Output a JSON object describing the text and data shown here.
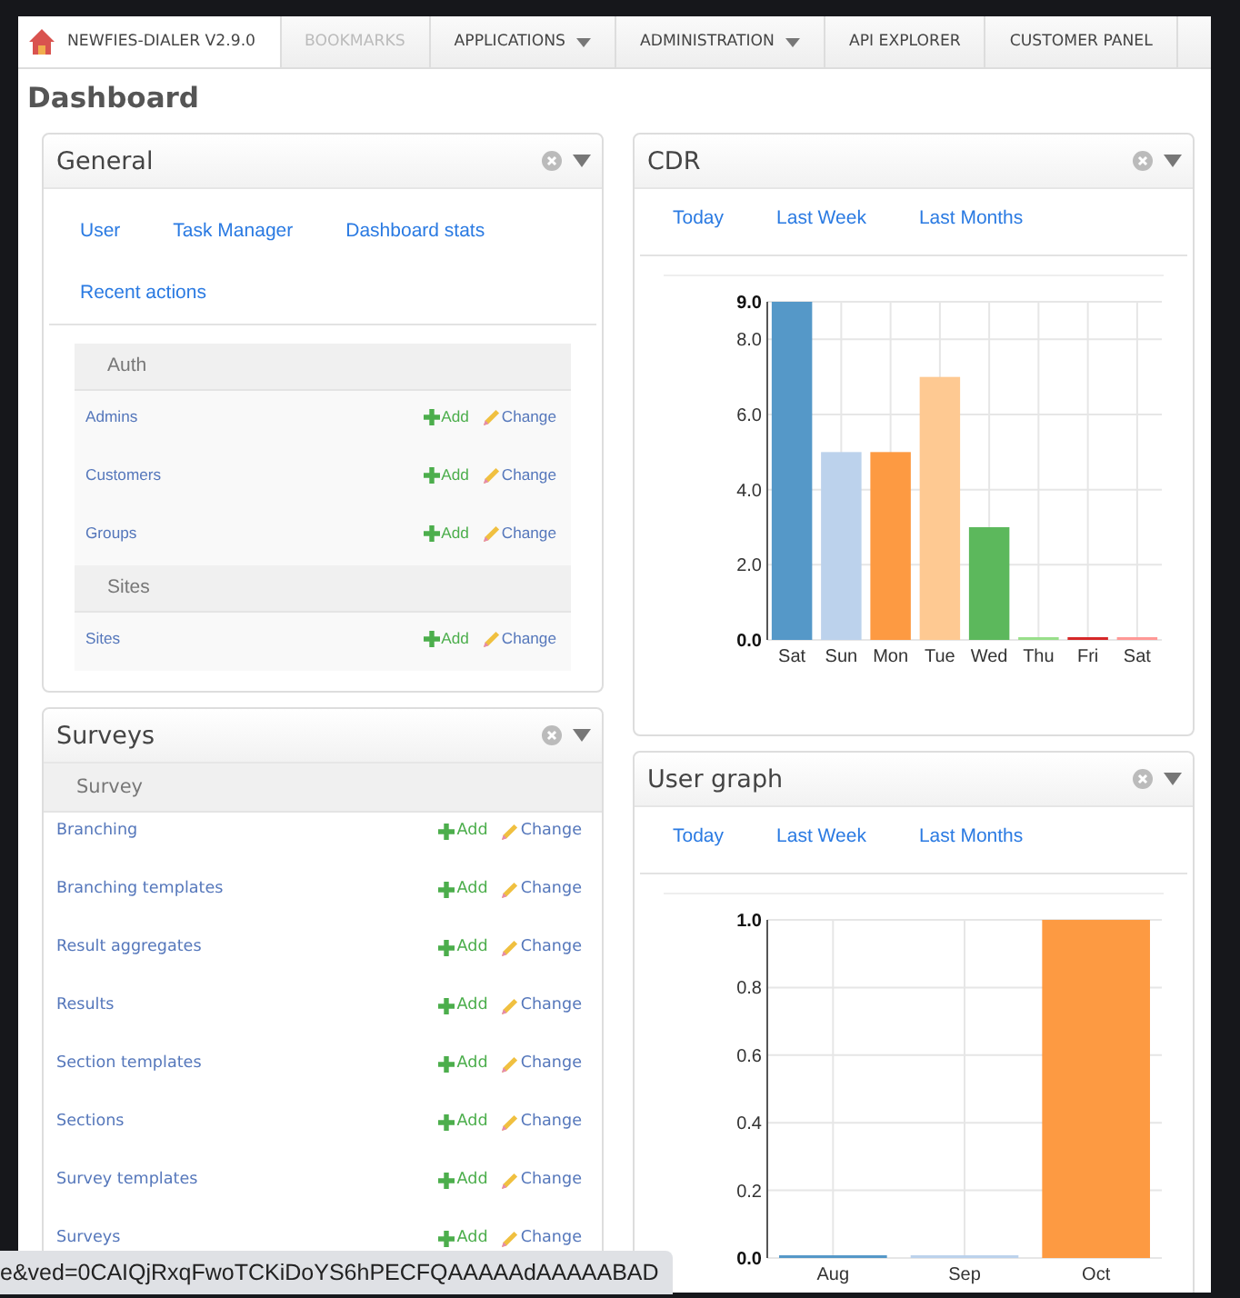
{
  "navbar": {
    "items": [
      {
        "label": "NEWFIES-DIALER V2.9.0",
        "kind": "brand",
        "selected": true,
        "disabled": false
      },
      {
        "label": "BOOKMARKS",
        "kind": "link",
        "selected": false,
        "disabled": true
      },
      {
        "label": "APPLICATIONS",
        "kind": "dropdown",
        "selected": false,
        "disabled": false
      },
      {
        "label": "ADMINISTRATION",
        "kind": "dropdown",
        "selected": false,
        "disabled": false
      },
      {
        "label": "API EXPLORER",
        "kind": "link",
        "selected": false,
        "disabled": false
      },
      {
        "label": "CUSTOMER PANEL",
        "kind": "link",
        "selected": false,
        "disabled": false
      }
    ]
  },
  "page_title": "Dashboard",
  "left_panels": [
    {
      "title": "General",
      "kind": "app_list",
      "links": [
        "User",
        "Task Manager",
        "Dashboard stats",
        "Recent actions"
      ],
      "groups": [
        {
          "name": "Auth",
          "rows": [
            {
              "label": "Admins",
              "add": "Add",
              "change": "Change"
            },
            {
              "label": "Customers",
              "add": "Add",
              "change": "Change"
            },
            {
              "label": "Groups",
              "add": "Add",
              "change": "Change"
            }
          ]
        },
        {
          "name": "Sites",
          "rows": [
            {
              "label": "Sites",
              "add": "Add",
              "change": "Change"
            }
          ]
        }
      ]
    },
    {
      "title": "Surveys",
      "kind": "models",
      "groups": [
        {
          "name": "Survey",
          "rows": [
            {
              "label": "Branching",
              "add": "Add",
              "change": "Change"
            },
            {
              "label": "Branching templates",
              "add": "Add",
              "change": "Change"
            },
            {
              "label": "Result aggregates",
              "add": "Add",
              "change": "Change"
            },
            {
              "label": "Results",
              "add": "Add",
              "change": "Change"
            },
            {
              "label": "Section templates",
              "add": "Add",
              "change": "Change"
            },
            {
              "label": "Sections",
              "add": "Add",
              "change": "Change"
            },
            {
              "label": "Survey templates",
              "add": "Add",
              "change": "Change"
            },
            {
              "label": "Surveys",
              "add": "Add",
              "change": "Change"
            }
          ]
        }
      ]
    }
  ],
  "right_panels": [
    {
      "title": "CDR",
      "tabs": [
        "Today",
        "Last Week",
        "Last Months"
      ],
      "chart_data": {
        "type": "bar",
        "stacked": true,
        "grid": true,
        "categories": [
          "Sat",
          "Sun",
          "Mon",
          "Tue",
          "Wed",
          "Thu",
          "Fri",
          "Sat"
        ],
        "ylim": [
          0,
          9
        ],
        "yticks": [
          {
            "value": 0,
            "label": "0.0"
          },
          {
            "value": 2,
            "label": "2.0"
          },
          {
            "value": 4,
            "label": "4.0"
          },
          {
            "value": 6,
            "label": "6.0"
          },
          {
            "value": 8,
            "label": "8.0"
          },
          {
            "value": 9,
            "label": "9.0"
          }
        ],
        "series": [
          {
            "color": "#5598c8",
            "values": [
              9,
              null,
              null,
              null,
              null,
              null,
              null,
              null
            ]
          },
          {
            "color": "#bcd2ec",
            "values": [
              null,
              5,
              null,
              null,
              null,
              null,
              null,
              null
            ]
          },
          {
            "color": "#fd9a42",
            "values": [
              null,
              null,
              5,
              null,
              null,
              null,
              null,
              null
            ]
          },
          {
            "color": "#fec992",
            "values": [
              null,
              null,
              null,
              7,
              null,
              null,
              null,
              null
            ]
          },
          {
            "color": "#5cb85c",
            "values": [
              null,
              null,
              null,
              null,
              3,
              null,
              null,
              null
            ]
          },
          {
            "color": "#98df8a",
            "values": [
              null,
              null,
              null,
              null,
              null,
              0,
              null,
              null
            ]
          },
          {
            "color": "#d62728",
            "values": [
              null,
              null,
              null,
              null,
              null,
              null,
              0,
              null
            ]
          },
          {
            "color": "#ff9896",
            "values": [
              null,
              null,
              null,
              null,
              null,
              null,
              null,
              0
            ]
          }
        ]
      }
    },
    {
      "title": "User graph",
      "tabs": [
        "Today",
        "Last Week",
        "Last Months"
      ],
      "chart_data": {
        "type": "bar",
        "stacked": true,
        "grid": true,
        "categories": [
          "Aug",
          "Sep",
          "Oct"
        ],
        "ylim": [
          0,
          1
        ],
        "yticks": [
          {
            "value": 0,
            "label": "0.0"
          },
          {
            "value": 0.2,
            "label": "0.2"
          },
          {
            "value": 0.4,
            "label": "0.4"
          },
          {
            "value": 0.6,
            "label": "0.6"
          },
          {
            "value": 0.8,
            "label": "0.8"
          },
          {
            "value": 1,
            "label": "1.0"
          }
        ],
        "series": [
          {
            "color": "#5598c8",
            "values": [
              0,
              null,
              null
            ]
          },
          {
            "color": "#bcd2ec",
            "values": [
              null,
              0,
              null
            ]
          },
          {
            "color": "#fd9a42",
            "values": [
              null,
              null,
              1
            ]
          }
        ]
      }
    }
  ],
  "status_url": "e&ved=0CAIQjRxqFwoTCKiDoYS6hPECFQAAAAAdAAAAABAD"
}
